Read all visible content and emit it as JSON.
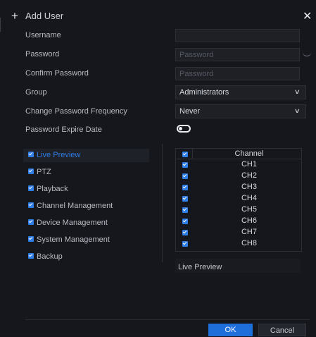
{
  "dialog": {
    "title": "Add User",
    "plus_glyph": "+",
    "close_glyph": "✕"
  },
  "form": {
    "username": {
      "label": "Username",
      "value": "",
      "placeholder": ""
    },
    "password": {
      "label": "Password",
      "value": "",
      "placeholder": "Password"
    },
    "confirm_password": {
      "label": "Confirm Password",
      "value": "",
      "placeholder": "Password"
    },
    "group": {
      "label": "Group",
      "selected": "Administrators"
    },
    "change_frequency": {
      "label": "Change Password Frequency",
      "selected": "Never"
    },
    "expire_date": {
      "label": "Password Expire Date",
      "enabled": false
    }
  },
  "permissions": {
    "items": [
      {
        "label": "Live Preview",
        "checked": true,
        "active": true
      },
      {
        "label": "PTZ",
        "checked": true
      },
      {
        "label": "Playback",
        "checked": true
      },
      {
        "label": "Channel Management",
        "checked": true
      },
      {
        "label": "Device Management",
        "checked": true
      },
      {
        "label": "System Management",
        "checked": true
      },
      {
        "label": "Backup",
        "checked": true
      }
    ]
  },
  "channels": {
    "header": "Channel",
    "rows": [
      "CH1",
      "CH2",
      "CH3",
      "CH4",
      "CH5",
      "CH6",
      "CH7",
      "CH8"
    ]
  },
  "scope_label": "Live Preview",
  "footer": {
    "ok_label": "OK",
    "cancel_label": "Cancel"
  },
  "colors": {
    "accent": "#2f7de6",
    "background": "#16171c",
    "field": "#1e2026"
  },
  "icons": {
    "plus": "plus-icon",
    "close": "close-icon",
    "chevron": "chevron-down-icon",
    "eye": "eye-icon",
    "checkbox": "checkbox-checked-icon"
  }
}
